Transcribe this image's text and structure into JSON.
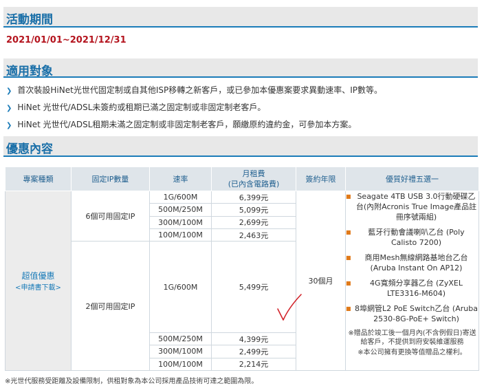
{
  "period": {
    "title": "活動期間",
    "dates": "2021/01/01~2021/12/31"
  },
  "eligibility": {
    "title": "適用對象",
    "items": [
      "首次裝設HiNet光世代固定制或自其他ISP移轉之新客戶，或已參加本優惠案要求異動速率、IP數等。",
      "HiNet 光世代/ADSL未簽約或租期已滿之固定制或非固定制老客戶。",
      "HiNet 光世代/ADSL租期未滿之固定制或非固定制老客戶，願繳原約違約金，可參加本方案。"
    ]
  },
  "offer": {
    "title": "優惠內容",
    "headers": [
      "專案種類",
      "固定IP數量",
      "速率",
      "月租費",
      "(已內含電路費)",
      "簽約年限",
      "優質好禮五選一"
    ],
    "plan_name": "超值優惠",
    "plan_link": "<申請書下載>",
    "contract": "30個月",
    "groups": [
      {
        "ip": "6個可用固定IP",
        "rows": [
          {
            "speed": "1G/600M",
            "fee": "6,399元"
          },
          {
            "speed": "500M/250M",
            "fee": "5,099元"
          },
          {
            "speed": "300M/100M",
            "fee": "2,699元"
          },
          {
            "speed": "100M/100M",
            "fee": "2,463元"
          }
        ]
      },
      {
        "ip": "2個可用固定IP",
        "rows": [
          {
            "speed": "1G/600M",
            "fee": "5,499元"
          },
          {
            "speed": "500M/250M",
            "fee": "4,399元"
          },
          {
            "speed": "300M/100M",
            "fee": "2,499元"
          },
          {
            "speed": "100M/100M",
            "fee": "2,214元"
          }
        ]
      }
    ],
    "gifts": [
      "Seagate 4TB USB 3.0行動硬碟乙台(內附Acronis True Image產品註冊序號兩組)",
      "藍牙行動會議喇叭乙台 (Poly Calisto 7200)",
      "商用Mesh無線網路基地台乙台 (Aruba Instant On AP12)",
      "4G寬頻分享器乙台 (ZyXEL LTE3316-M604)",
      "8埠網管L2 PoE Switch乙台 (Aruba 2530-8G-PoE+ Switch)"
    ],
    "gift_notes": [
      "※贈品於竣工後一個月內(不含例假日)寄送給客戶，不提供到府安裝維運服務",
      "※本公司擁有更換等值贈品之權利。"
    ]
  },
  "footnote": "※光世代服務受距離及設備限制，供租對象為本公司採用產品技術可達之範圍為限。",
  "colors": {
    "accent": "#1a7bb8",
    "date_red": "#b4141e",
    "header_bg": "#dfe5ea",
    "bullet_orange": "#e07a1a",
    "check_red": "#d2232a"
  }
}
